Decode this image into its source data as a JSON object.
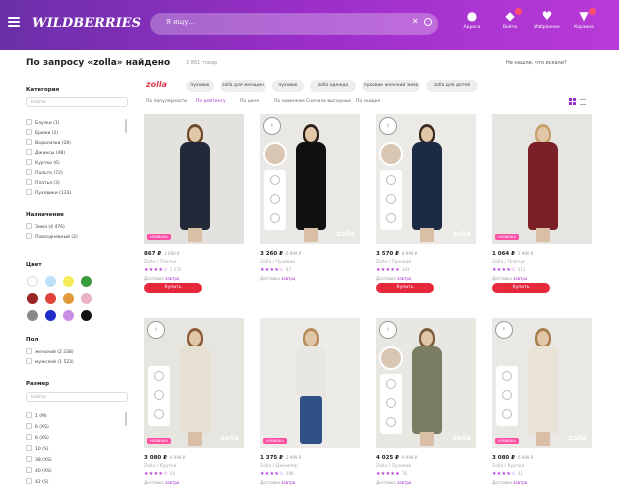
{
  "header": {
    "logo": "WILDBERRIES",
    "search_placeholder": "Я ищу...",
    "actions": [
      {
        "label": "Адреса",
        "icon": "location-icon"
      },
      {
        "label": "Войти",
        "icon": "user-icon"
      },
      {
        "label": "Избранное",
        "icon": "heart-icon"
      },
      {
        "label": "Корзина",
        "icon": "cart-icon"
      }
    ]
  },
  "results": {
    "title": "По запросу «zolla» найдено",
    "count": "3 861 товар",
    "not_found_link": "Не нашли, что искали?"
  },
  "quick_tags": {
    "primary": "zolla",
    "chips": [
      "пуховик",
      "zolla для женщин",
      "пуховик",
      "zolla одежда",
      "пуховик женский зима",
      "zolla для детей"
    ]
  },
  "sort_options": [
    "По популярности",
    "По рейтингу",
    "По цене",
    "По новинкам",
    "Сначала выгодные",
    "По скидке"
  ],
  "filters": {
    "category": {
      "title": "Категория",
      "placeholder": "Найти",
      "items": [
        "Блузки (1)",
        "Брюки (2)",
        "Водолазки (28)",
        "Джинсы (48)",
        "Куртки (6)",
        "Пальто (72)",
        "Платья (3)",
        "Пуховики (133)"
      ]
    },
    "purpose": {
      "title": "Назначение",
      "items": [
        "Зима (4 476)",
        "Повседневный (2)"
      ]
    },
    "color": {
      "title": "Цвет",
      "swatches": [
        "#ffffff",
        "#bfe0f8",
        "#f5ec5a",
        "#3a9a3f",
        "#9b2424",
        "#e0463b",
        "#e39a3c",
        "#e9b3c5",
        "#8a8a8a",
        "#1f2ccc",
        "#c98ee6",
        "#111111"
      ]
    },
    "gender": {
      "title": "Пол",
      "items": [
        "женский (2 338)",
        "мужской (1 523)"
      ]
    },
    "size": {
      "title": "Размер",
      "placeholder": "Найти",
      "items": [
        "1 (М)",
        "6 (XS)",
        "8 (XS)",
        "10 (S)",
        "38 (XS)",
        "40 (XS)",
        "42 (S)"
      ]
    }
  },
  "products": [
    {
      "price": "867 ₽",
      "old_price": "2 690 ₽",
      "brand": "Zolla / Платье",
      "rating": "★★★★☆",
      "reviews": "1 235",
      "delivery_prefix": "Доставка",
      "delivery": "завтра",
      "button": "Купить",
      "badge": "НОВИНКА",
      "watermark": ""
    },
    {
      "price": "3 260 ₽",
      "old_price": "6 999 ₽",
      "brand": "Zolla / Пуховик",
      "rating": "★★★★☆",
      "reviews": "87",
      "delivery_prefix": "Доставка",
      "delivery": "завтра",
      "button": "",
      "badge": "",
      "watermark": "zolla"
    },
    {
      "price": "3 570 ₽",
      "old_price": "8 999 ₽",
      "brand": "Zolla / Пуховик",
      "rating": "★★★★★",
      "reviews": "143",
      "delivery_prefix": "Доставка",
      "delivery": "завтра",
      "button": "Купить",
      "badge": "",
      "watermark": "zolla"
    },
    {
      "price": "1 064 ₽",
      "old_price": "2 990 ₽",
      "brand": "Zolla / Платье",
      "rating": "★★★★☆",
      "reviews": "512",
      "delivery_prefix": "Доставка",
      "delivery": "завтра",
      "button": "Купить",
      "badge": "НОВИНКА",
      "watermark": ""
    },
    {
      "price": "3 080 ₽",
      "old_price": "6 999 ₽",
      "brand": "Zolla / Куртка",
      "rating": "★★★★☆",
      "reviews": "64",
      "delivery_prefix": "Доставка",
      "delivery": "завтра",
      "button": "",
      "badge": "НОВИНКА",
      "watermark": "zolla"
    },
    {
      "price": "1 375 ₽",
      "old_price": "2 999 ₽",
      "brand": "Zolla / Джемпер",
      "rating": "★★★★☆",
      "reviews": "298",
      "delivery_prefix": "Доставка",
      "delivery": "завтра",
      "button": "",
      "badge": "НОВИНКА",
      "watermark": ""
    },
    {
      "price": "4 025 ₽",
      "old_price": "9 999 ₽",
      "brand": "Zolla / Пуховик",
      "rating": "★★★★★",
      "reviews": "76",
      "delivery_prefix": "Доставка",
      "delivery": "завтра",
      "button": "",
      "badge": "",
      "watermark": "zolla"
    },
    {
      "price": "3 080 ₽",
      "old_price": "6 999 ₽",
      "brand": "Zolla / Куртка",
      "rating": "★★★★☆",
      "reviews": "41",
      "delivery_prefix": "Доставка",
      "delivery": "завтра",
      "button": "",
      "badge": "НОВИНКА",
      "watermark": "zolla"
    }
  ],
  "colors": {
    "brand": "#9b2fc8",
    "buy_button": "#e5283c",
    "star": "#b33ad6"
  }
}
